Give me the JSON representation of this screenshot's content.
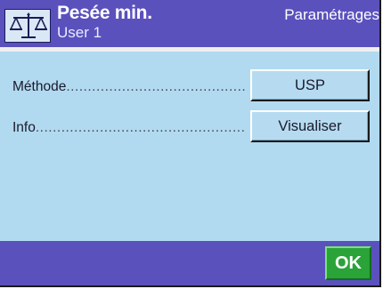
{
  "header": {
    "title": "Pesée min.",
    "user": "User 1",
    "section": "Paramétrages",
    "icon": "balance-scale-icon"
  },
  "settings": [
    {
      "label": "Méthode",
      "value": "USP"
    },
    {
      "label": "Info",
      "value": "Visualiser"
    }
  ],
  "footer": {
    "ok_label": "OK"
  },
  "colors": {
    "header_bg": "#5b51bd",
    "content_bg": "#b1daf0",
    "ok_button": "#2aa339"
  }
}
